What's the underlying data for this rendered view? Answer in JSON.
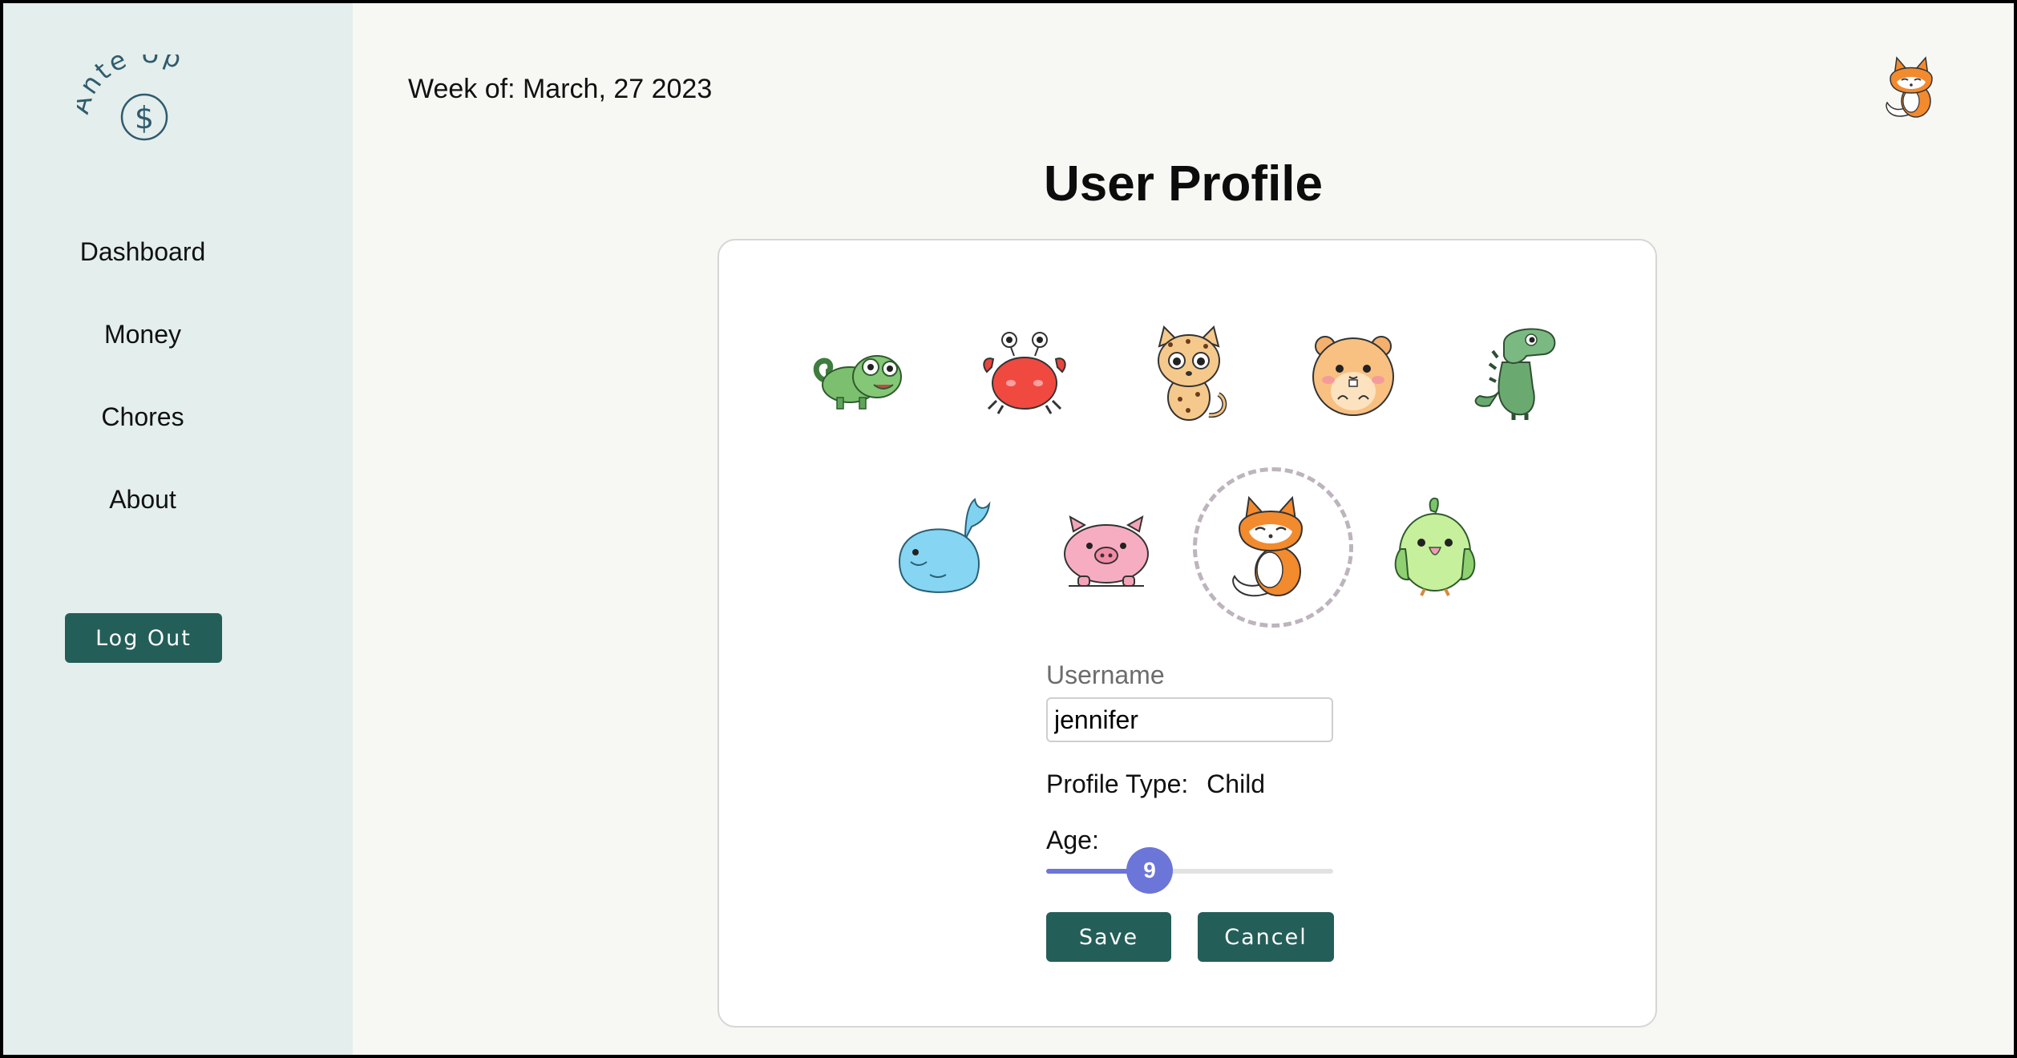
{
  "app": {
    "name": "Ante Up"
  },
  "sidebar": {
    "nav": [
      {
        "label": "Dashboard"
      },
      {
        "label": "Money"
      },
      {
        "label": "Chores"
      },
      {
        "label": "About"
      }
    ],
    "logout_label": "Log Out"
  },
  "header": {
    "week_label": "Week of: March, 27 2023",
    "avatar_icon": "fox-icon"
  },
  "page": {
    "title": "User Profile"
  },
  "profile": {
    "avatar_options": [
      {
        "icon": "chameleon-icon",
        "selected": false
      },
      {
        "icon": "crab-icon",
        "selected": false
      },
      {
        "icon": "leopard-icon",
        "selected": false
      },
      {
        "icon": "hamster-icon",
        "selected": false
      },
      {
        "icon": "dinosaur-icon",
        "selected": false
      },
      {
        "icon": "whale-icon",
        "selected": false
      },
      {
        "icon": "pig-icon",
        "selected": false
      },
      {
        "icon": "fox-icon",
        "selected": true
      },
      {
        "icon": "parrot-icon",
        "selected": false
      }
    ],
    "username_label": "Username",
    "username_value": "jennifer",
    "profile_type_label": "Profile Type:",
    "profile_type_value": "Child",
    "age_label": "Age:",
    "age_value": "9",
    "age_fraction": 0.36,
    "save_label": "Save",
    "cancel_label": "Cancel"
  },
  "colors": {
    "sidebar_bg": "#e4eeec",
    "primary_button": "#245e58",
    "slider_accent": "#6c75d8",
    "page_bg": "#f7f8f4"
  }
}
